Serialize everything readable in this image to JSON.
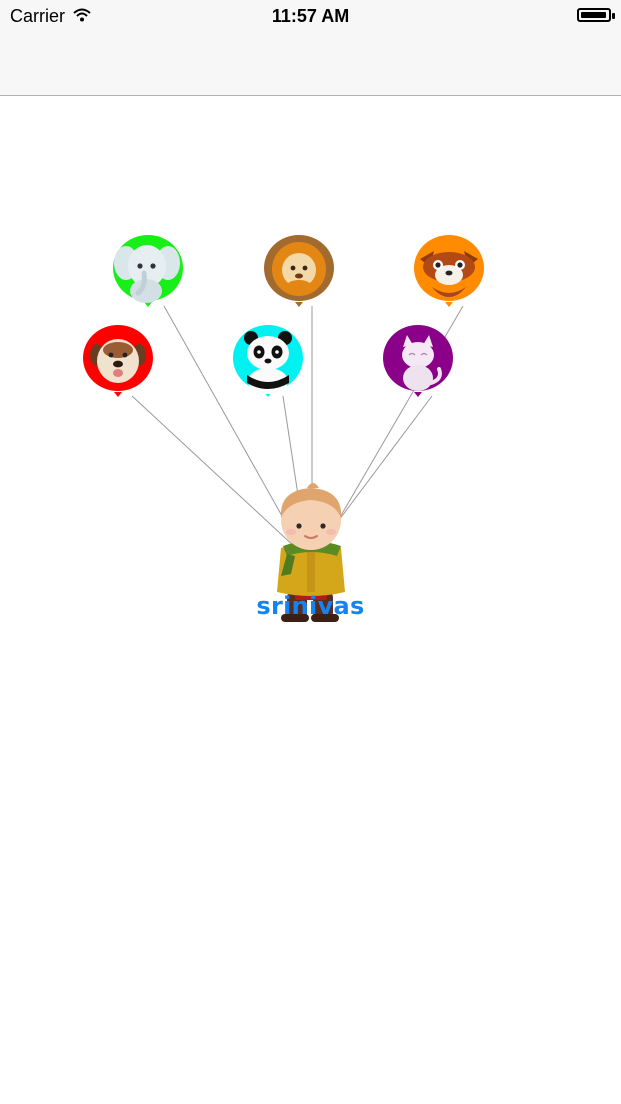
{
  "status_bar": {
    "carrier": "Carrier",
    "time": "11:57 AM",
    "battery_level": 0.95
  },
  "balloons": [
    {
      "animal": "elephant-icon",
      "color": "#18ee18"
    },
    {
      "animal": "lion-icon",
      "color": "#a36a2d"
    },
    {
      "animal": "fox-icon",
      "color": "#ff8b00"
    },
    {
      "animal": "dog-icon",
      "color": "#ff0000"
    },
    {
      "animal": "panda-icon",
      "color": "#00f1f1"
    },
    {
      "animal": "cat-icon",
      "color": "#8a0089"
    }
  ],
  "boy": {
    "name": "srinivas"
  },
  "colors": {
    "name_text": "#1583f0",
    "string": "#9a9a9a"
  }
}
